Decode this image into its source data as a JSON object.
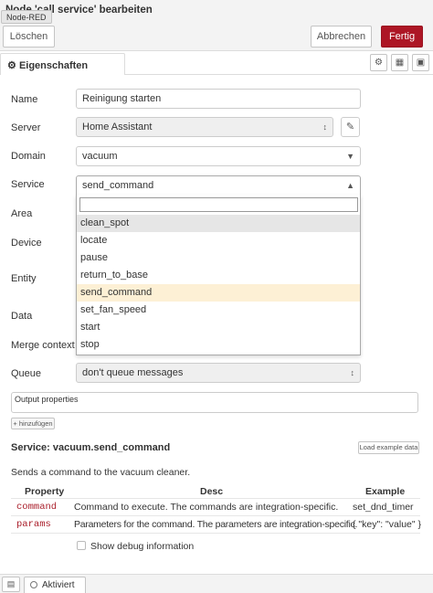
{
  "header": {
    "title": "Node 'call service' bearbeiten",
    "tooltip": "Node-RED",
    "delete_label": "Löschen",
    "cancel_label": "Abbrechen",
    "done_label": "Fertig",
    "done_color": "#ad1625"
  },
  "tabs": {
    "properties_label": "Eigenschaften",
    "icons": [
      "gear-icon",
      "document-icon",
      "layout-icon"
    ]
  },
  "form": {
    "name_label": "Name",
    "name_value": "Reinigung starten",
    "server_label": "Server",
    "server_value": "Home Assistant",
    "domain_label": "Domain",
    "domain_value": "vacuum",
    "service_label": "Service",
    "service_value": "send_command",
    "area_label": "Area",
    "device_label": "Device",
    "entity_label": "Entity",
    "data_label": "Data",
    "merge_label": "Merge context",
    "queue_label": "Queue",
    "queue_value": "don't queue messages"
  },
  "dropdown": {
    "search_value": "",
    "options": [
      "clean_spot",
      "locate",
      "pause",
      "return_to_base",
      "send_command",
      "set_fan_speed",
      "start",
      "stop"
    ],
    "hovered": "clean_spot",
    "selected": "send_command",
    "hover_color": "#e6e6e6",
    "selected_color": "#fdf0d5"
  },
  "output": {
    "title": "Output properties",
    "add_label": "+ hinzufügen"
  },
  "service_info": {
    "title": "Service: vacuum.send_command",
    "load_label": "Load example data",
    "description": "Sends a command to the vacuum cleaner.",
    "columns": [
      "Property",
      "Desc",
      "Example"
    ],
    "rows": [
      {
        "property": "command",
        "desc": "Command to execute. The commands are integration-specific.",
        "example": "set_dnd_timer"
      },
      {
        "property": "params",
        "desc": "Parameters for the command. The parameters are integration-specific.",
        "example": "{ \"key\": \"value\" }"
      }
    ],
    "debug_label": "Show debug information",
    "debug_checked": false
  },
  "footer": {
    "icon": "book-icon",
    "active_label": "Aktiviert"
  }
}
